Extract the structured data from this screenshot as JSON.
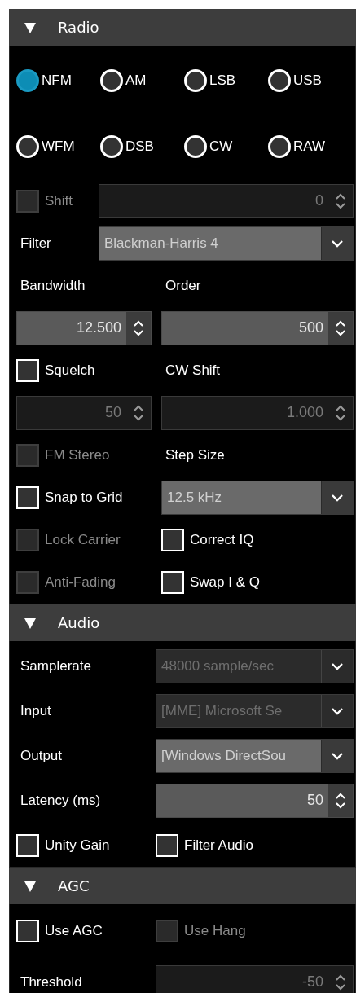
{
  "sections": [
    {
      "title": "Radio",
      "expanded": true,
      "rows": [
        {
          "kind": "radios",
          "cells": [
            {
              "kind": "radio",
              "label": "NFM",
              "selected": true
            },
            {
              "kind": "radio",
              "label": "AM",
              "selected": false
            },
            {
              "kind": "radio",
              "label": "LSB",
              "selected": false
            },
            {
              "kind": "radio",
              "label": "USB",
              "selected": false
            }
          ]
        },
        {
          "kind": "radios",
          "cells": [
            {
              "kind": "radio",
              "label": "WFM",
              "selected": false
            },
            {
              "kind": "radio",
              "label": "DSB",
              "selected": false
            },
            {
              "kind": "radio",
              "label": "CW",
              "selected": false
            },
            {
              "kind": "radio",
              "label": "RAW",
              "selected": false
            }
          ]
        },
        {
          "kind": "narrow",
          "cells": [
            {
              "kind": "check",
              "label": "Shift",
              "checked": false,
              "disabled": true
            },
            {
              "kind": "spin",
              "value": "0",
              "disabled": true
            }
          ]
        },
        {
          "kind": "narrow",
          "cells": [
            {
              "kind": "label",
              "text": "Filter"
            },
            {
              "kind": "combo",
              "value": "Blackman-Harris 4",
              "disabled": false
            }
          ]
        },
        {
          "kind": "half",
          "cells": [
            {
              "kind": "label",
              "text": "Bandwidth"
            },
            {
              "kind": "label",
              "text": "Order"
            }
          ]
        },
        {
          "kind": "half",
          "cells": [
            {
              "kind": "spin",
              "value": "12.500",
              "disabled": false
            },
            {
              "kind": "spin",
              "value": "500",
              "disabled": false
            }
          ]
        },
        {
          "kind": "half",
          "cells": [
            {
              "kind": "check",
              "label": "Squelch",
              "checked": false,
              "disabled": false
            },
            {
              "kind": "label",
              "text": "CW Shift"
            }
          ]
        },
        {
          "kind": "half",
          "cells": [
            {
              "kind": "spin",
              "value": "50",
              "disabled": true
            },
            {
              "kind": "spin",
              "value": "1.000",
              "disabled": true
            }
          ]
        },
        {
          "kind": "half",
          "cells": [
            {
              "kind": "check",
              "label": "FM Stereo",
              "checked": false,
              "disabled": true
            },
            {
              "kind": "label",
              "text": "Step Size"
            }
          ]
        },
        {
          "kind": "half",
          "cells": [
            {
              "kind": "check",
              "label": "Snap to Grid",
              "checked": false,
              "disabled": false
            },
            {
              "kind": "combo",
              "value": "12.5 kHz",
              "disabled": false
            }
          ]
        },
        {
          "kind": "half",
          "cells": [
            {
              "kind": "check",
              "label": "Lock Carrier",
              "checked": false,
              "disabled": true
            },
            {
              "kind": "check",
              "label": "Correct IQ",
              "checked": false,
              "disabled": false
            }
          ]
        },
        {
          "kind": "half",
          "cells": [
            {
              "kind": "check",
              "label": "Anti-Fading",
              "checked": false,
              "disabled": true
            },
            {
              "kind": "check",
              "label": "Swap I & Q",
              "checked": false,
              "disabled": false
            }
          ]
        }
      ]
    },
    {
      "title": "Audio",
      "expanded": true,
      "rows": [
        {
          "kind": "wide",
          "cells": [
            {
              "kind": "label",
              "text": "Samplerate"
            },
            {
              "kind": "combo",
              "value": "48000 sample/sec",
              "disabled": true
            }
          ]
        },
        {
          "kind": "wide",
          "cells": [
            {
              "kind": "label",
              "text": "Input"
            },
            {
              "kind": "combo",
              "value": "[MME] Microsoft Se",
              "disabled": true
            }
          ]
        },
        {
          "kind": "wide",
          "cells": [
            {
              "kind": "label",
              "text": "Output"
            },
            {
              "kind": "combo",
              "value": "[Windows DirectSou",
              "disabled": false
            }
          ]
        },
        {
          "kind": "wide",
          "cells": [
            {
              "kind": "label",
              "text": "Latency (ms)"
            },
            {
              "kind": "spin",
              "value": "50",
              "disabled": false
            }
          ]
        },
        {
          "kind": "wide",
          "cells": [
            {
              "kind": "check",
              "label": "Unity Gain",
              "checked": false,
              "disabled": false
            },
            {
              "kind": "check",
              "label": "Filter Audio",
              "checked": false,
              "disabled": false
            }
          ]
        }
      ]
    },
    {
      "title": "AGC",
      "expanded": true,
      "rows": [
        {
          "kind": "wide",
          "cells": [
            {
              "kind": "check",
              "label": "Use AGC",
              "checked": false,
              "disabled": false
            },
            {
              "kind": "check",
              "label": "Use Hang",
              "checked": false,
              "disabled": true
            }
          ]
        },
        {
          "kind": "wide",
          "cells": [
            {
              "kind": "label",
              "text": "Threshold"
            },
            {
              "kind": "spin",
              "value": "-50",
              "disabled": true
            }
          ]
        }
      ]
    }
  ]
}
